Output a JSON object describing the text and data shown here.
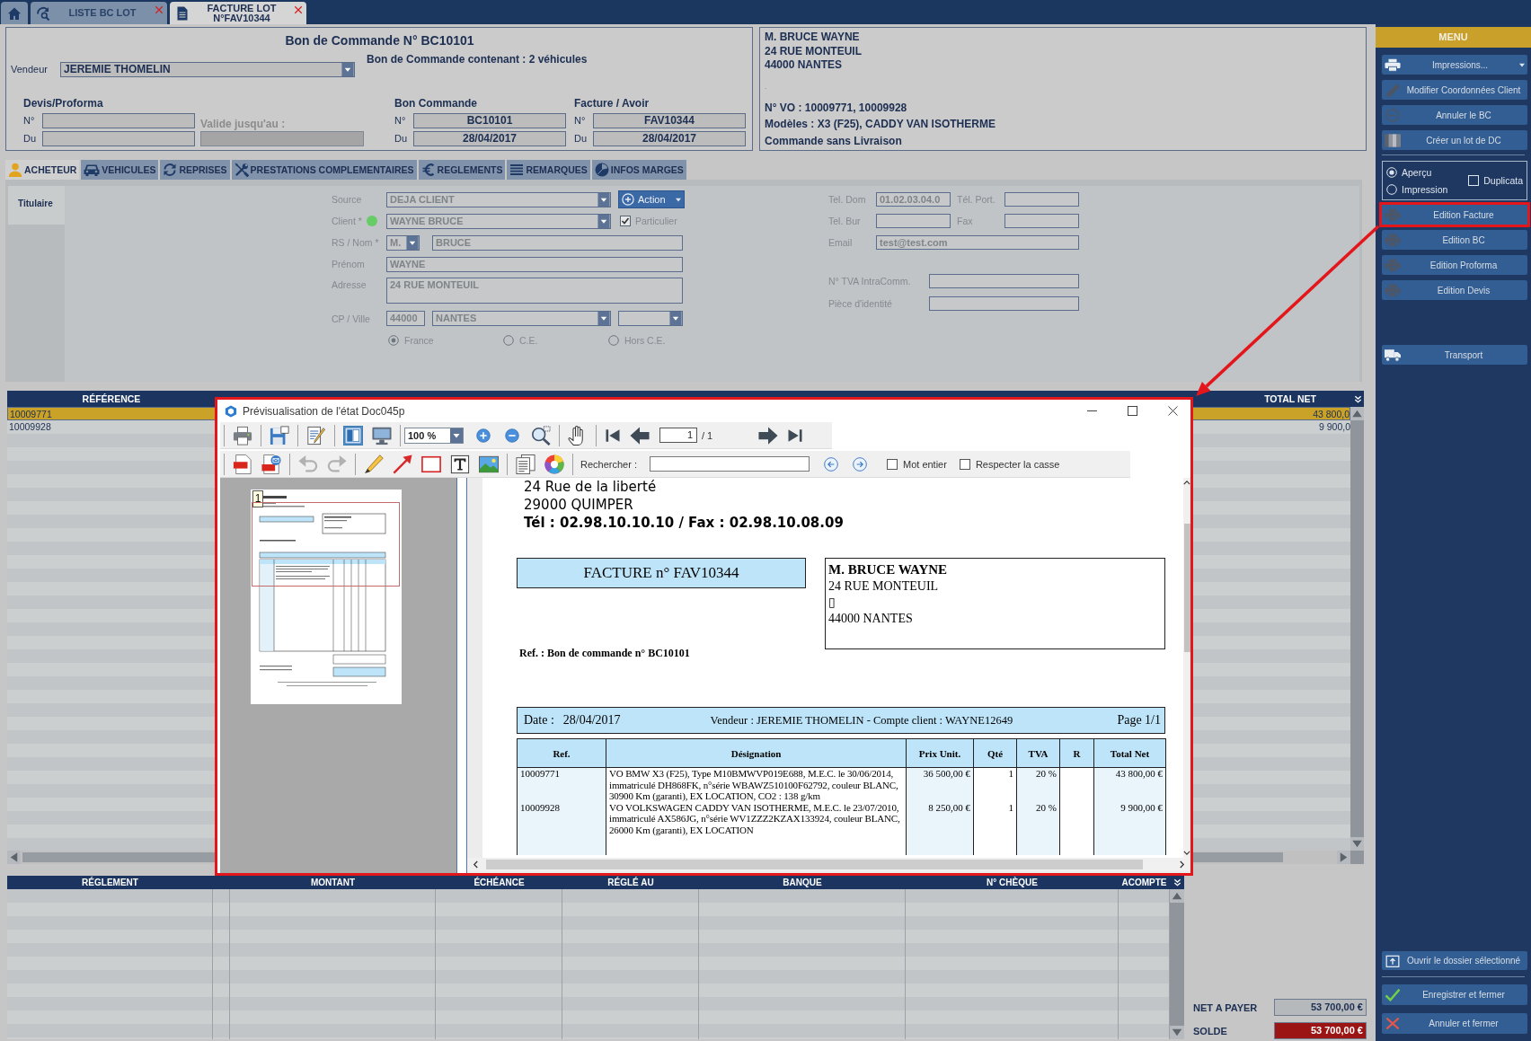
{
  "top_tabs": [
    {
      "kind": "home",
      "selected": false,
      "closable": false
    },
    {
      "kind": "list",
      "label": [
        "LISTE BC LOT"
      ],
      "selected": false,
      "closable": true
    },
    {
      "kind": "document",
      "label": [
        "FACTURE LOT",
        "N°FAV10344"
      ],
      "selected": true,
      "closable": true
    }
  ],
  "order_header": {
    "title": "Bon de Commande N° BC10101",
    "vendor": {
      "label": "Vendeur",
      "value": "JEREMIE THOMELIN"
    },
    "summary": "Bon de Commande contenant : 2 véhicules",
    "groups": [
      {
        "heading": "Devis/Proforma",
        "fields": [
          {
            "label": "N°"
          },
          {
            "label": "Du"
          }
        ],
        "validity": {
          "label": "Valide jusqu'au :",
          "disabled": true
        }
      },
      {
        "heading": "Bon Commande",
        "fields": [
          {
            "label": "N°",
            "value": "BC10101"
          },
          {
            "label": "Du",
            "value": "28/04/2017"
          }
        ]
      },
      {
        "heading": "Facture / Avoir",
        "fields": [
          {
            "label": "N°",
            "value": "FAV10344"
          },
          {
            "label": "Du",
            "value": "28/04/2017"
          }
        ]
      }
    ]
  },
  "client_summary": {
    "address_lines": [
      "M. BRUCE WAYNE",
      "24 RUE MONTEUIL",
      "44000 NANTES"
    ],
    "note": ".",
    "info_lines": [
      "N° VO : 10009771, 10009928",
      "Modèles : X3 (F25), CADDY VAN ISOTHERME",
      "Commande sans Livraison"
    ]
  },
  "section_tabs": [
    {
      "label": "ACHETEUR",
      "selected": true
    },
    {
      "label": "VEHICULES",
      "selected": false
    },
    {
      "label": "REPRISES",
      "selected": false
    },
    {
      "label": "PRESTATIONS COMPLEMENTAIRES",
      "selected": false
    },
    {
      "label": "REGLEMENTS",
      "selected": false
    },
    {
      "label": "REMARQUES",
      "selected": false
    },
    {
      "label": "INFOS MARGES",
      "selected": false
    }
  ],
  "buyer": {
    "disabled": true,
    "panel_label": "Titulaire",
    "source": {
      "label": "Source",
      "value": "DEJA CLIENT"
    },
    "action_button": {
      "label": "Action"
    },
    "client": {
      "label": "Client *",
      "value": "WAYNE BRUCE"
    },
    "particulier": {
      "label": "Particulier",
      "checked": true
    },
    "name": {
      "label": "RS / Nom *",
      "civility": "M.",
      "value": "BRUCE"
    },
    "first_name": {
      "label": "Prénom",
      "value": "WAYNE"
    },
    "address": {
      "label": "Adresse",
      "value": "24 RUE MONTEUIL"
    },
    "city": {
      "label": "CP / Ville",
      "postcode": "44000",
      "value": "NANTES"
    },
    "zones": [
      {
        "label": "France",
        "selected": true
      },
      {
        "label": "C.E.",
        "selected": false
      },
      {
        "label": "Hors C.E.",
        "selected": false
      }
    ],
    "contacts": [
      [
        {
          "label": "Tel. Dom",
          "value": "01.02.03.04.0"
        },
        {
          "label": "Tél. Port."
        }
      ],
      [
        {
          "label": "Tel. Bur"
        },
        {
          "label": "Fax"
        }
      ],
      [
        {
          "label": "Email",
          "value": "test@test.com"
        }
      ]
    ],
    "ids": [
      {
        "label": "N° TVA IntraComm."
      },
      {
        "label": "Pièce d'identité"
      }
    ]
  },
  "vehicles_table": {
    "columns": [
      "RÉFÉRENCE",
      "TOTAL NET"
    ],
    "rows": [
      {
        "reference": "10009771",
        "total_net": "43 800,0",
        "selected": true
      },
      {
        "reference": "10009928",
        "total_net": "9 900,0",
        "selected": false
      }
    ]
  },
  "payments_table": {
    "columns": [
      "RÉGLEMENT",
      "MONTANT",
      "ÉCHÉANCE",
      "RÉGLÉ AU",
      "BANQUE",
      "N° CHÈQUE",
      "ACOMPTE"
    ]
  },
  "totals": [
    {
      "label": "NET A PAYER",
      "value": "53 700,00 €",
      "kind": "total"
    },
    {
      "label": "SOLDE",
      "value": "53 700,00 €",
      "kind": "balance"
    }
  ],
  "menu": {
    "title": "MENU",
    "actions": [
      {
        "label": "Impressions...",
        "dropdown": true
      },
      {
        "label": "Modifier Coordonnées Client",
        "dropdown": false
      },
      {
        "label": "Annuler le BC",
        "dropdown": false
      },
      {
        "label": "Créer un lot de DC",
        "dropdown": false
      }
    ],
    "output_modes": [
      {
        "label": "Aperçu",
        "selected": true
      },
      {
        "label": "Impression",
        "selected": false
      }
    ],
    "duplicata": {
      "label": "Duplicata",
      "checked": false
    },
    "editions": [
      {
        "label": "Edition Facture",
        "highlighted": true
      },
      {
        "label": "Edition BC",
        "highlighted": false
      },
      {
        "label": "Edition Proforma",
        "highlighted": false
      },
      {
        "label": "Edition Devis",
        "highlighted": false
      }
    ],
    "transport": {
      "label": "Transport"
    },
    "footer_actions": [
      {
        "label": "Ouvrir le dossier sélectionné"
      },
      {
        "label": "Enregistrer et fermer"
      },
      {
        "label": "Annuler et fermer"
      }
    ]
  },
  "preview_window": {
    "title": "Prévisualisation de l'état Doc045p",
    "highlighted": true,
    "toolbars": [
      [
        [
          {
            "kind": "tool",
            "pressed": false,
            "disabled": false
          }
        ],
        [
          {
            "kind": "tool",
            "pressed": false,
            "disabled": false
          }
        ],
        [
          {
            "kind": "tool",
            "pressed": false,
            "disabled": false
          }
        ],
        [
          {
            "kind": "tool",
            "pressed": true,
            "disabled": false
          },
          {
            "kind": "tool",
            "pressed": false,
            "disabled": false
          }
        ],
        [
          {
            "kind": "select",
            "value": "100 %"
          },
          {
            "kind": "tool",
            "pressed": false,
            "disabled": false
          },
          {
            "kind": "tool",
            "pressed": false,
            "disabled": false
          },
          {
            "kind": "tool",
            "pressed": false,
            "disabled": false
          }
        ],
        [
          {
            "kind": "tool",
            "pressed": false,
            "disabled": false
          }
        ],
        [
          {
            "kind": "tool",
            "pressed": false,
            "disabled": false
          },
          {
            "kind": "tool",
            "pressed": false,
            "disabled": false
          },
          {
            "kind": "page",
            "value": "1",
            "total": "/ 1"
          },
          {
            "kind": "tool",
            "pressed": false,
            "disabled": false
          },
          {
            "kind": "tool",
            "pressed": false,
            "disabled": false
          }
        ]
      ],
      [
        [
          {
            "kind": "tool",
            "pressed": false,
            "disabled": false
          },
          {
            "kind": "tool",
            "pressed": false,
            "disabled": false
          }
        ],
        [
          {
            "kind": "tool",
            "pressed": false,
            "disabled": true
          },
          {
            "kind": "tool",
            "pressed": false,
            "disabled": true
          }
        ],
        [
          {
            "kind": "tool",
            "pressed": false,
            "disabled": false
          },
          {
            "kind": "tool",
            "pressed": false,
            "disabled": false
          },
          {
            "kind": "tool",
            "pressed": false,
            "disabled": false
          },
          {
            "kind": "tool",
            "pressed": false,
            "disabled": false
          },
          {
            "kind": "tool",
            "pressed": false,
            "disabled": false
          }
        ],
        [
          {
            "kind": "tool",
            "pressed": false,
            "disabled": false
          },
          {
            "kind": "tool",
            "pressed": false,
            "disabled": false
          }
        ],
        [
          {
            "kind": "label",
            "text": "Rechercher :"
          },
          {
            "kind": "search"
          },
          {
            "kind": "tool",
            "pressed": false,
            "disabled": false
          },
          {
            "kind": "tool",
            "pressed": false,
            "disabled": false
          },
          {
            "kind": "checkbox",
            "label": "Mot entier",
            "checked": false
          },
          {
            "kind": "checkbox",
            "label": "Respecter la casse",
            "checked": false
          }
        ]
      ]
    ],
    "thumbnail": {
      "page_label": "1"
    },
    "document": {
      "sender_lines": [
        "24 Rue de la liberté",
        "29000 QUIMPER"
      ],
      "sender_contact": "Tél : 02.98.10.10.10 / Fax : 02.98.10.08.09",
      "title": "FACTURE n° FAV10344",
      "recipient": {
        "name": "M. BRUCE WAYNE",
        "lines": [
          "24 RUE MONTEUIL",
          "▯",
          "44000 NANTES"
        ]
      },
      "reference": "Ref. : Bon de commande n° BC10101",
      "info": {
        "date_label": "Date :",
        "date": "28/04/2017",
        "details": "Vendeur : JEREMIE THOMELIN - Compte client : WAYNE12649",
        "page": "Page 1/1"
      },
      "table": {
        "columns": [
          "Ref.",
          "Désignation",
          "Prix Unit.",
          "Qté",
          "TVA",
          "R",
          "Total Net"
        ],
        "rows": [
          {
            "ref": "10009771",
            "designation": "VO BMW X3 (F25), Type M10BMWVP019E688, M.E.C. le 30/06/2014, immatriculé DH868FK, n°série WBAWZ510100F62792, couleur BLANC, 30900 Km (garanti), EX LOCATION, CO2 : 138 g/km",
            "unit_price": "36 500,00 €",
            "qty": "1",
            "vat": "20 %",
            "total": "43 800,00 €"
          },
          {
            "ref": "10009928",
            "designation": "VO VOLKSWAGEN CADDY VAN ISOTHERME, M.E.C. le 23/07/2010, immatriculé AX586JG, n°série WV1ZZZ2KZAX133924, couleur BLANC, 26000 Km (garanti), EX LOCATION",
            "unit_price": "8 250,00 €",
            "qty": "1",
            "vat": "20 %",
            "total": "9 900,00 €"
          }
        ]
      }
    }
  }
}
